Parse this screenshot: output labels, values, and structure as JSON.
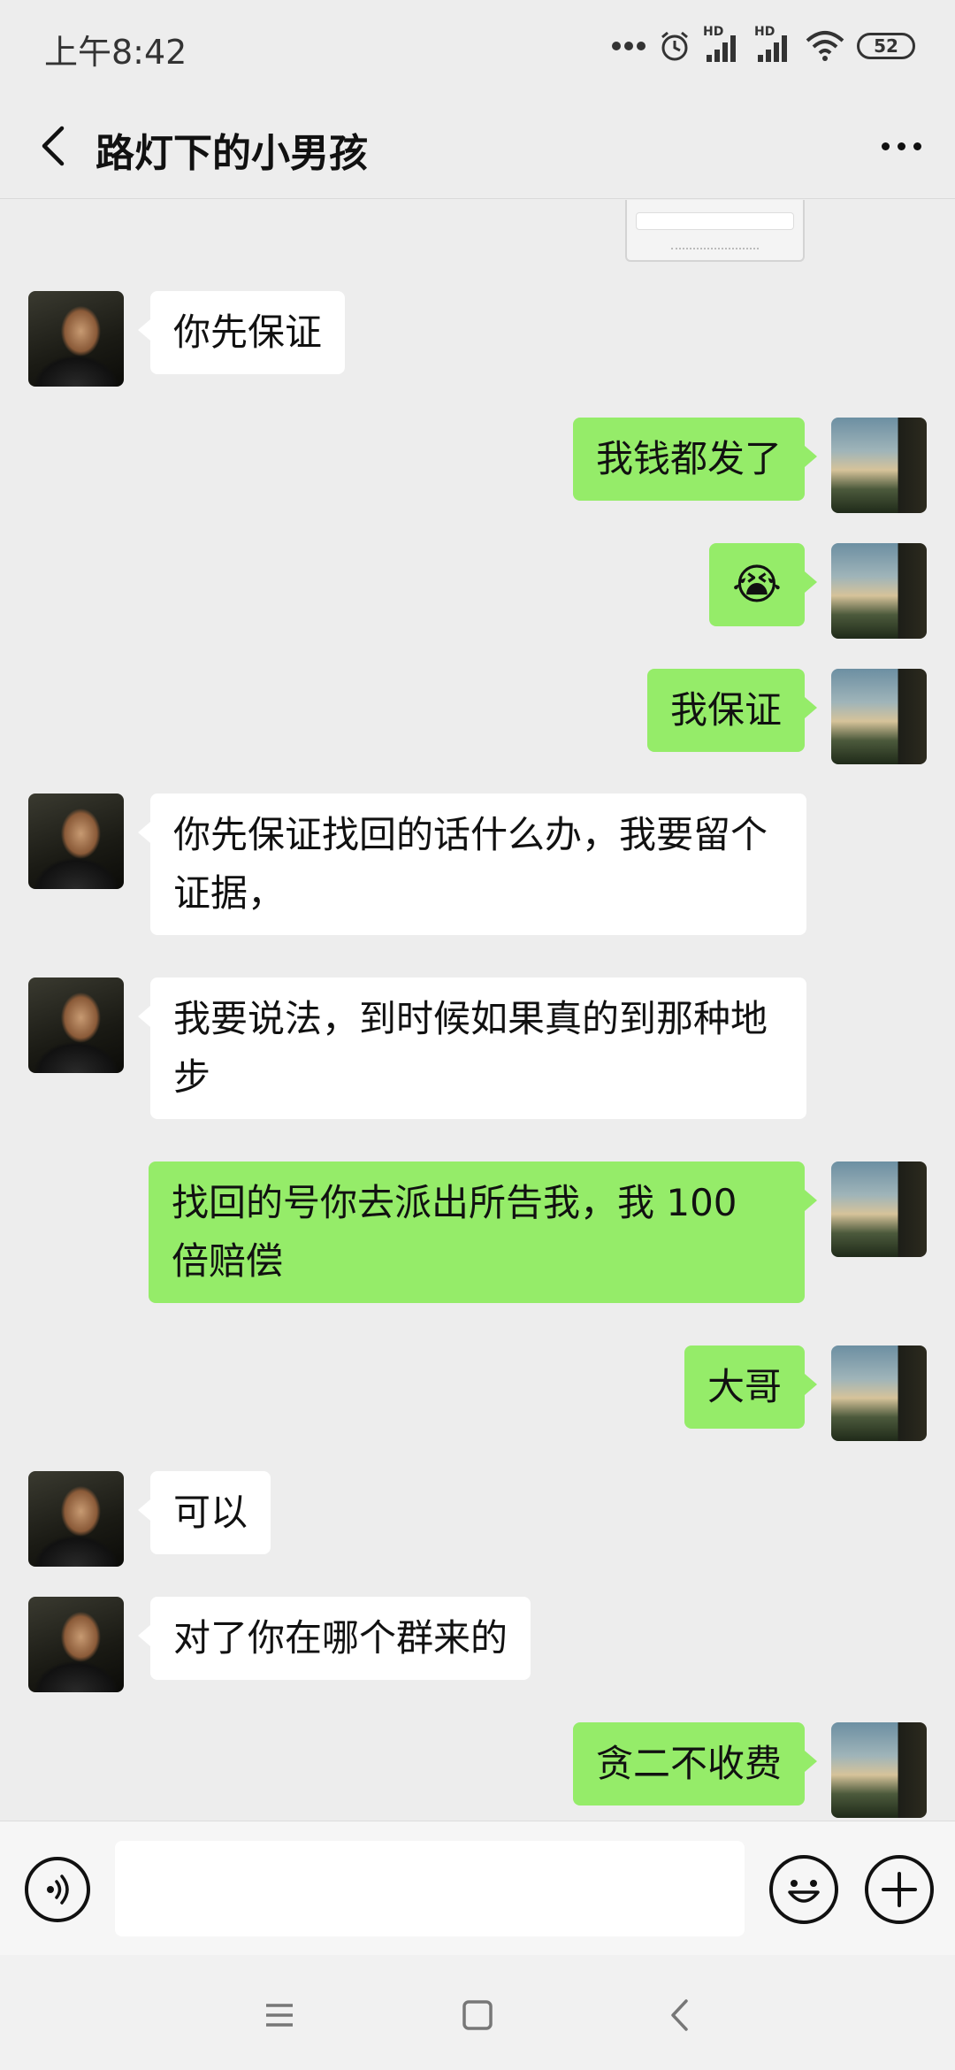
{
  "status_bar": {
    "time": "上午8:42",
    "battery": "52",
    "hd_label_1": "HD",
    "hd_label_2": "HD",
    "icons": [
      "more-dots-icon",
      "alarm-icon",
      "signal-icon",
      "signal-icon",
      "wifi-icon",
      "battery-icon"
    ]
  },
  "header": {
    "title": "路灯下的小男孩",
    "back_icon": "chevron-left-icon",
    "more_icon": "more-dots-icon"
  },
  "messages": [
    {
      "sender": "peer",
      "text": "你先保证"
    },
    {
      "sender": "self",
      "text": "我钱都发了"
    },
    {
      "sender": "self",
      "text": "😭"
    },
    {
      "sender": "self",
      "text": "我保证"
    },
    {
      "sender": "peer",
      "text": "你先保证找回的话什么办，我要留个证据，"
    },
    {
      "sender": "peer",
      "text": "我要说法，到时候如果真的到那种地步"
    },
    {
      "sender": "self",
      "text": "找回的号你去派出所告我，我 100 倍赔偿"
    },
    {
      "sender": "self",
      "text": "大哥"
    },
    {
      "sender": "peer",
      "text": "可以"
    },
    {
      "sender": "peer",
      "text": "对了你在哪个群来的"
    },
    {
      "sender": "self",
      "text": "贪二不收费"
    }
  ],
  "input_bar": {
    "value": "",
    "voice_icon": "voice-icon",
    "emoji_icon": "emoji-icon",
    "plus_icon": "plus-icon"
  },
  "nav_bar": {
    "icons": [
      "menu-icon",
      "home-square-icon",
      "back-triangle-icon"
    ]
  },
  "colors": {
    "background": "#ededed",
    "self_bubble": "#95ec69",
    "peer_bubble": "#ffffff"
  }
}
